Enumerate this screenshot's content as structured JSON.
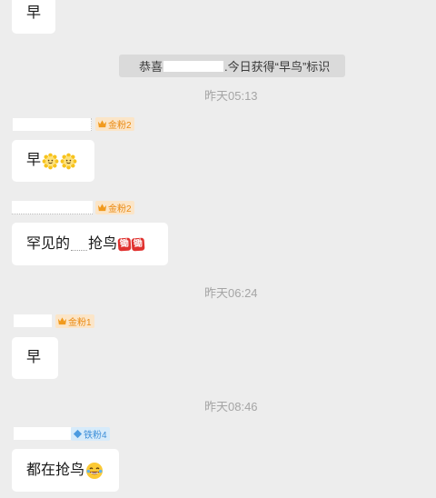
{
  "system_notice": {
    "prefix": "恭喜",
    "suffix": ".今日获得“早鸟”标识"
  },
  "timestamps": [
    "昨天05:13",
    "昨天06:24",
    "昨天08:46"
  ],
  "messages": [
    {
      "text": "早"
    },
    {
      "badge": "金粉2",
      "badge_type": "gold",
      "text": "早"
    },
    {
      "badge": "金粉2",
      "badge_type": "gold",
      "text_pre": "罕见的",
      "text_post": "抢鸟",
      "stickers": [
        "锄",
        "锄"
      ]
    },
    {
      "badge": "金粉1",
      "badge_type": "gold",
      "text": "早"
    },
    {
      "badge": "铁粉4",
      "badge_type": "iron",
      "text": "都在抢鸟"
    }
  ],
  "colors": {
    "background": "#ededed",
    "bubble": "#ffffff",
    "gold_badge_bg": "#fbe5c8",
    "gold_badge_text": "#ea8a12",
    "iron_badge_bg": "#d7ebfa",
    "iron_badge_text": "#3e8fd8",
    "sticker": "#e0322f"
  }
}
